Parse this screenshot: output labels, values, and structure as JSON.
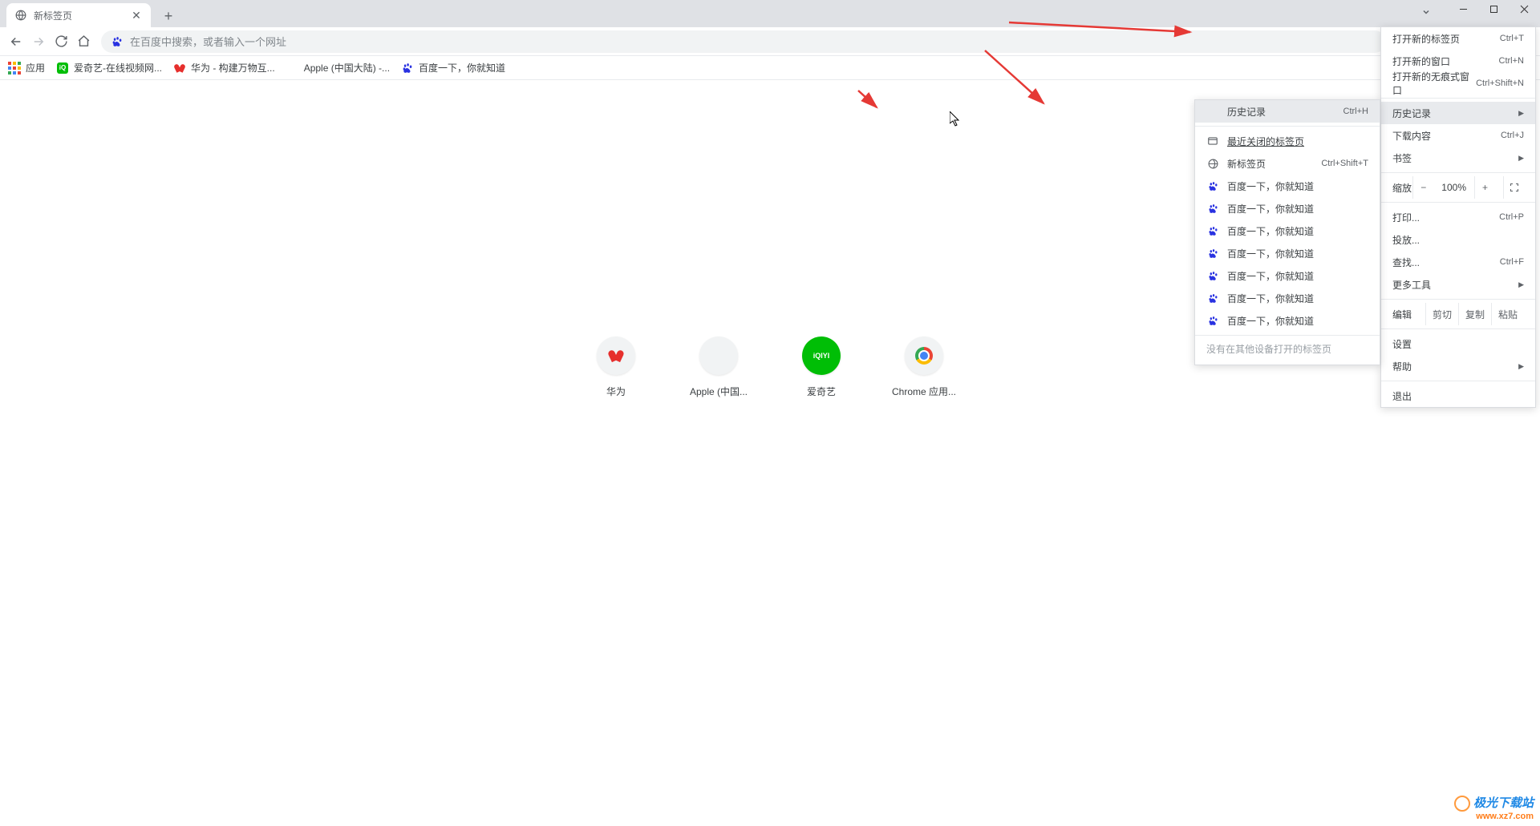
{
  "tab": {
    "title": "新标签页"
  },
  "omnibox": {
    "placeholder": "在百度中搜索，或者输入一个网址"
  },
  "bookmarks": {
    "apps": "应用",
    "iqiyi": "爱奇艺-在线视频网...",
    "huawei": "华为 - 构建万物互...",
    "apple": "Apple (中国大陆) -...",
    "baidu": "百度一下，你就知道"
  },
  "shortcuts": {
    "huawei": "华为",
    "apple": "Apple (中国...",
    "iqiyi": "爱奇艺",
    "iqiyi_tile": "iQIYI",
    "chrome": "Chrome 应用..."
  },
  "menu": {
    "new_tab": "打开新的标签页",
    "new_tab_k": "Ctrl+T",
    "new_window": "打开新的窗口",
    "new_window_k": "Ctrl+N",
    "incognito": "打开新的无痕式窗口",
    "incognito_k": "Ctrl+Shift+N",
    "history": "历史记录",
    "downloads": "下载内容",
    "downloads_k": "Ctrl+J",
    "bookmarks": "书签",
    "zoom_label": "缩放",
    "zoom_value": "100%",
    "print": "打印...",
    "print_k": "Ctrl+P",
    "cast": "投放...",
    "find": "查找...",
    "find_k": "Ctrl+F",
    "more_tools": "更多工具",
    "edit_label": "编辑",
    "cut": "剪切",
    "copy": "复制",
    "paste": "粘贴",
    "settings": "设置",
    "help": "帮助",
    "exit": "退出"
  },
  "submenu": {
    "history": "历史记录",
    "history_k": "Ctrl+H",
    "recently_closed": "最近关闭的标签页",
    "new_tab": "新标签页",
    "new_tab_k": "Ctrl+Shift+T",
    "baidu_entry": "百度一下，你就知道",
    "no_other_devices": "没有在其他设备打开的标签页"
  },
  "watermark": {
    "name": "极光下载站",
    "url": "www.xz7.com"
  }
}
